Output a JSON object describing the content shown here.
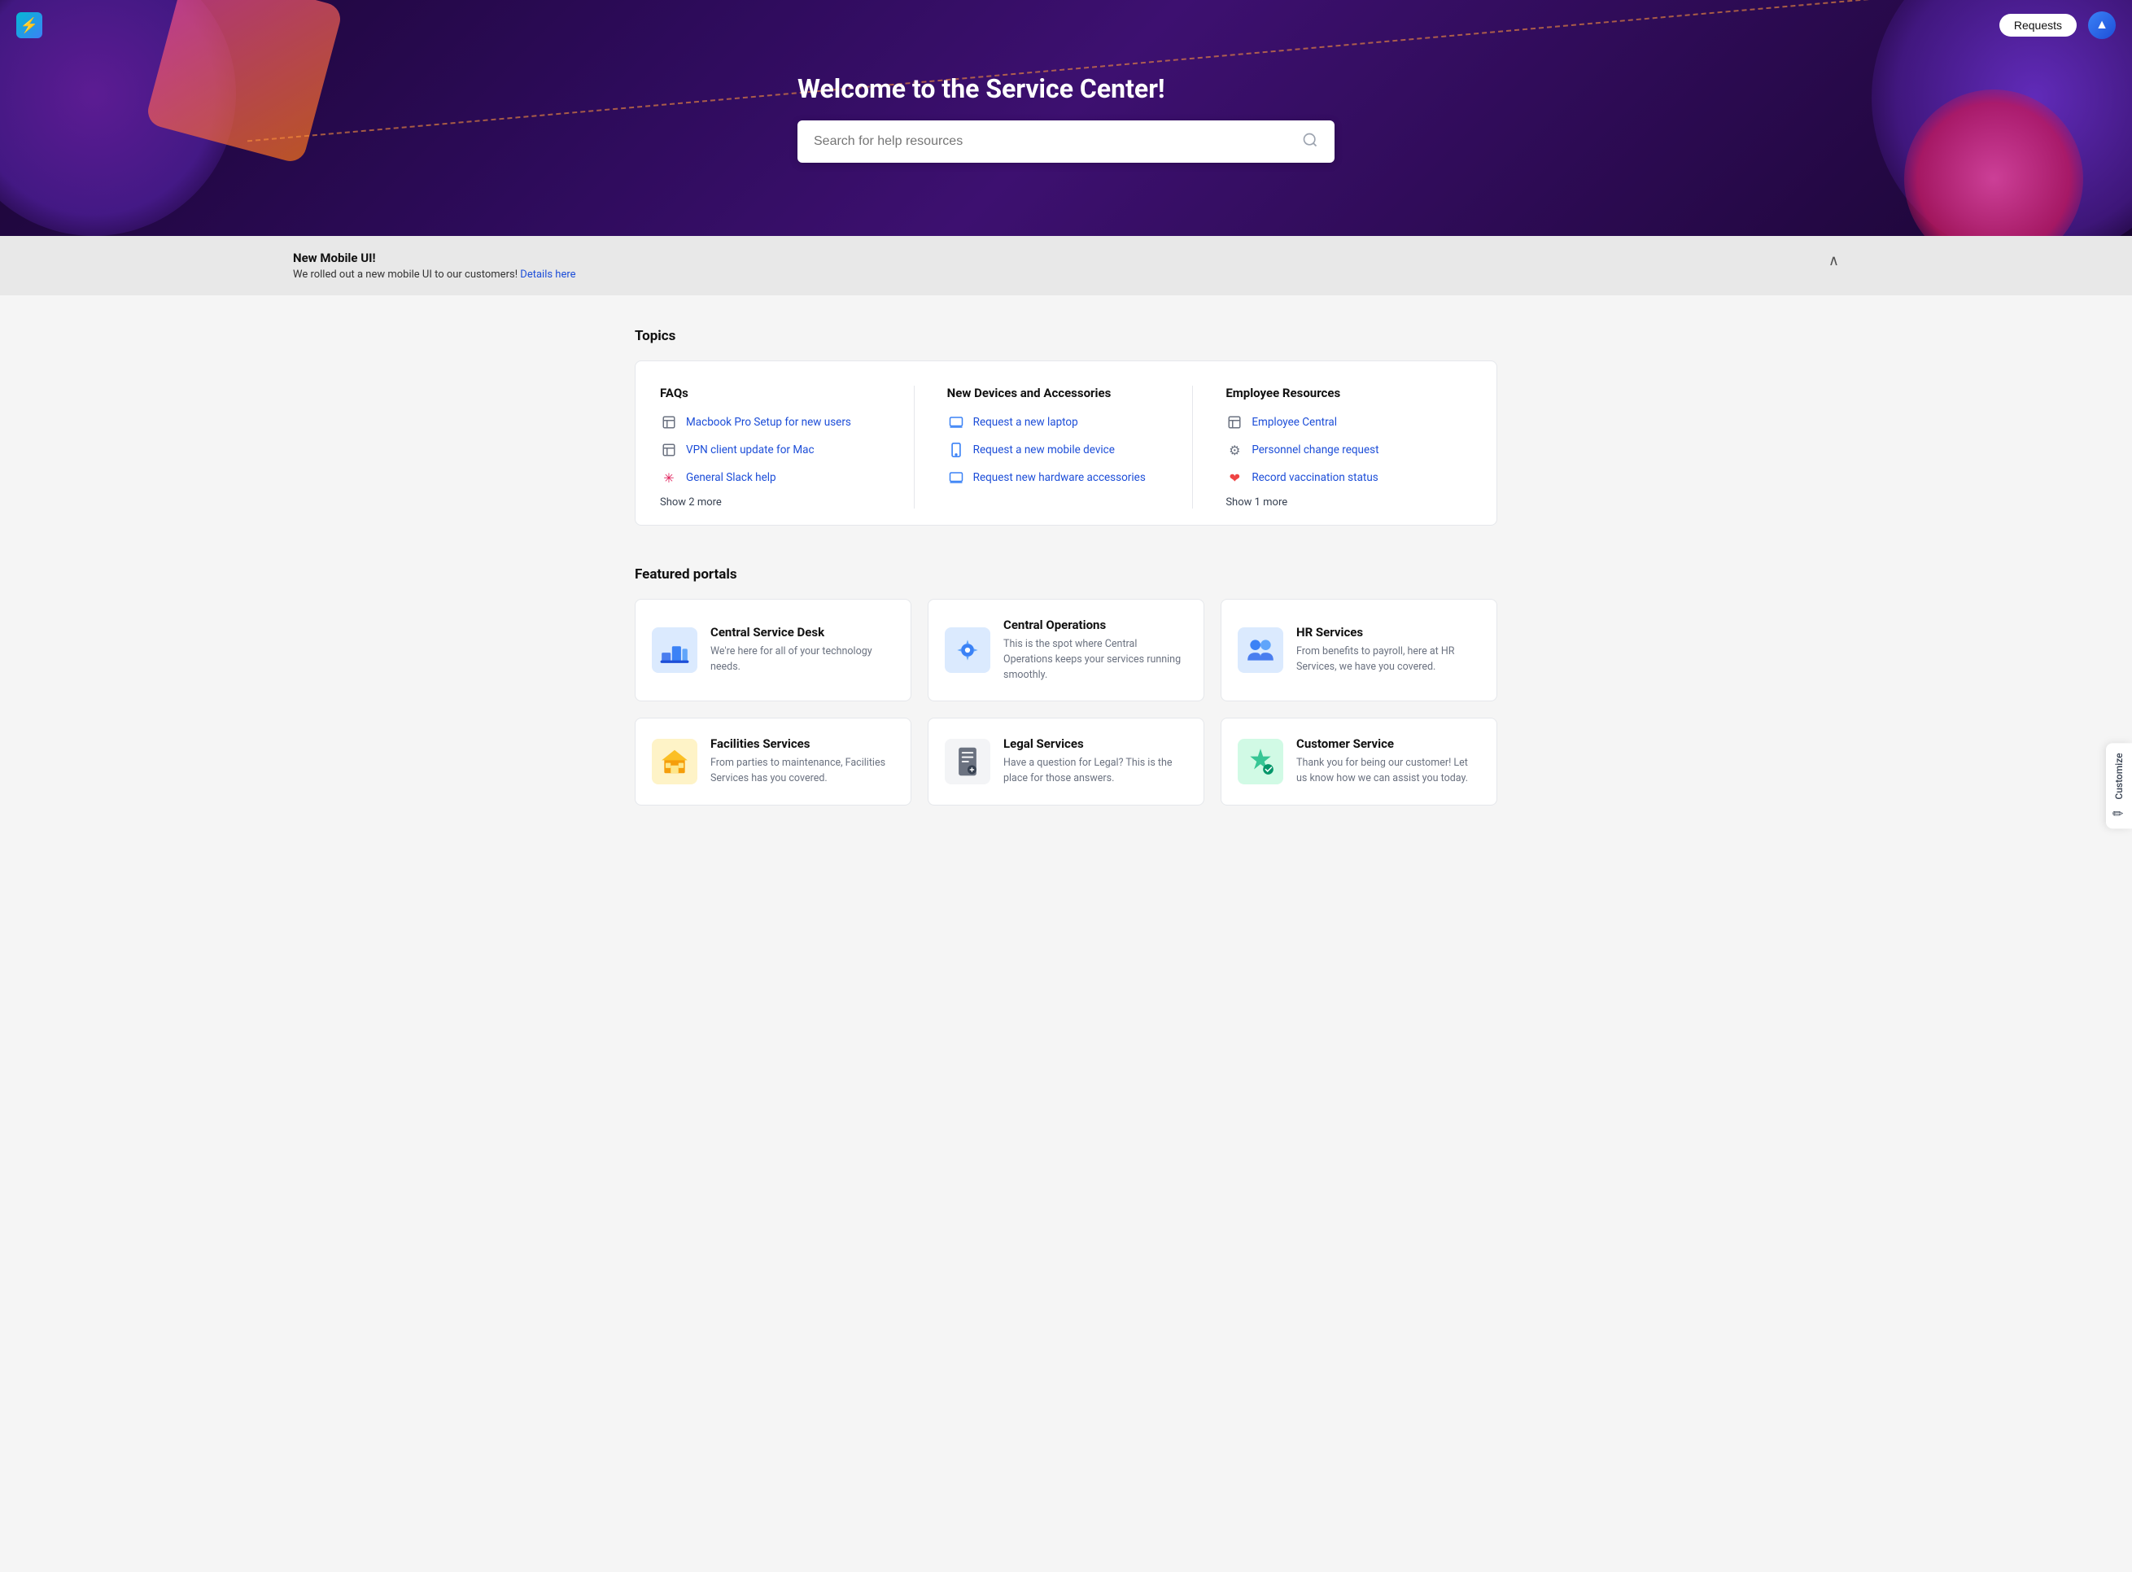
{
  "nav": {
    "logo_symbol": "⚡",
    "requests_label": "Requests",
    "avatar_symbol": "▲"
  },
  "hero": {
    "title": "Welcome to the Service Center!",
    "search_placeholder": "Search for help resources"
  },
  "customize_tab": {
    "label": "Customize",
    "icon": "✏"
  },
  "banner": {
    "title": "New Mobile UI!",
    "description": "We rolled out a new mobile UI to our customers!",
    "link_text": "Details here",
    "chevron": "∧"
  },
  "topics": {
    "section_title": "Topics",
    "columns": [
      {
        "title": "FAQs",
        "items": [
          {
            "label": "Macbook Pro Setup for new users",
            "icon": "📋"
          },
          {
            "label": "VPN client update for Mac",
            "icon": "📋"
          },
          {
            "label": "General Slack help",
            "icon": "✳"
          }
        ],
        "show_more": "Show 2 more"
      },
      {
        "title": "New Devices and Accessories",
        "items": [
          {
            "label": "Request a new laptop",
            "icon": "💻"
          },
          {
            "label": "Request a new mobile device",
            "icon": "📱"
          },
          {
            "label": "Request new hardware accessories",
            "icon": "🖥"
          }
        ],
        "show_more": null
      },
      {
        "title": "Employee Resources",
        "items": [
          {
            "label": "Employee Central",
            "icon": "📋"
          },
          {
            "label": "Personnel change request",
            "icon": "⚙"
          },
          {
            "label": "Record vaccination status",
            "icon": "❤"
          }
        ],
        "show_more": "Show 1 more"
      }
    ]
  },
  "portals": {
    "section_title": "Featured portals",
    "items": [
      {
        "title": "Central Service Desk",
        "description": "We're here for all of your technology needs.",
        "icon": "🏗",
        "icon_bg": "#dbeafe"
      },
      {
        "title": "Central Operations",
        "description": "This is the spot where Central Operations keeps your services running smoothly.",
        "icon": "⚙",
        "icon_bg": "#dbeafe"
      },
      {
        "title": "HR Services",
        "description": "From benefits to payroll, here at HR Services, we have you covered.",
        "icon": "🤝",
        "icon_bg": "#dbeafe"
      },
      {
        "title": "Facilities Services",
        "description": "From parties to maintenance, Facilities Services has you covered.",
        "icon": "🏢",
        "icon_bg": "#fef3c7"
      },
      {
        "title": "Legal Services",
        "description": "Have a question for Legal? This is the place for those answers.",
        "icon": "📱",
        "icon_bg": "#f3f4f6"
      },
      {
        "title": "Customer Service",
        "description": "Thank you for being our customer! Let us know how we can assist you today.",
        "icon": "🛡",
        "icon_bg": "#d1fae5"
      }
    ]
  }
}
